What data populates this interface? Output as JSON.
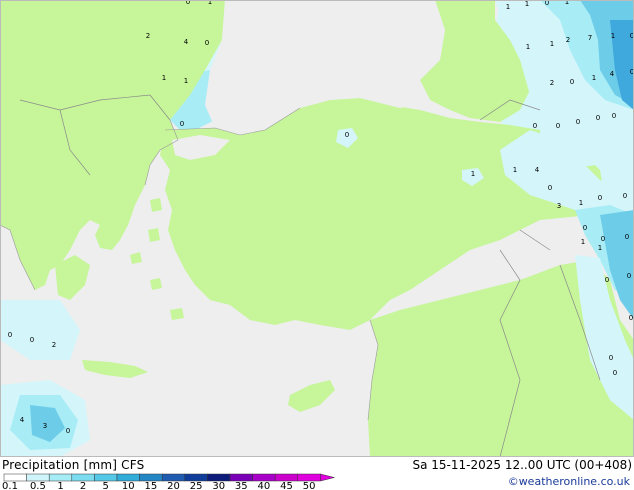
{
  "footer": {
    "title": "Precipitation [mm]  CFS",
    "datetime": "Sa 15-11-2025 12..00 UTC (00+408)",
    "credit": "©weatheronline.co.uk"
  },
  "legend": {
    "labels": [
      "0.1",
      "0.5",
      "1",
      "2",
      "5",
      "10",
      "15",
      "20",
      "25",
      "30",
      "35",
      "40",
      "45",
      "50"
    ],
    "colors": [
      "#ffffff",
      "#cff5fb",
      "#a6ecf6",
      "#7cdcef",
      "#55c8e8",
      "#32acd9",
      "#2586c6",
      "#1f5bb0",
      "#103d9a",
      "#0c1c7a",
      "#7a00b8",
      "#a800c8",
      "#cc00cc",
      "#e000dd"
    ]
  },
  "map": {
    "colors": {
      "land": "#c6f59a",
      "sea": "#eeeeee",
      "precip_light": "#d4f6fb",
      "precip_medium": "#a8ecf6",
      "precip_heavy": "#6dcde9",
      "precip_strong": "#3fa8dc"
    },
    "value_labels": [
      "0",
      "1",
      "1",
      "1",
      "0",
      "1",
      "2",
      "4",
      "0",
      "1",
      "1",
      "2",
      "7",
      "1",
      "0",
      "1",
      "1",
      "2",
      "0",
      "1",
      "4",
      "0",
      "0",
      "0",
      "0",
      "0",
      "0",
      "0",
      "0",
      "1",
      "1",
      "4",
      "3",
      "1",
      "0",
      "0",
      "1",
      "0",
      "0",
      "0",
      "0",
      "0",
      "0",
      "0",
      "2",
      "4",
      "3",
      "0",
      "0",
      "0",
      "0",
      "0",
      "1"
    ]
  }
}
